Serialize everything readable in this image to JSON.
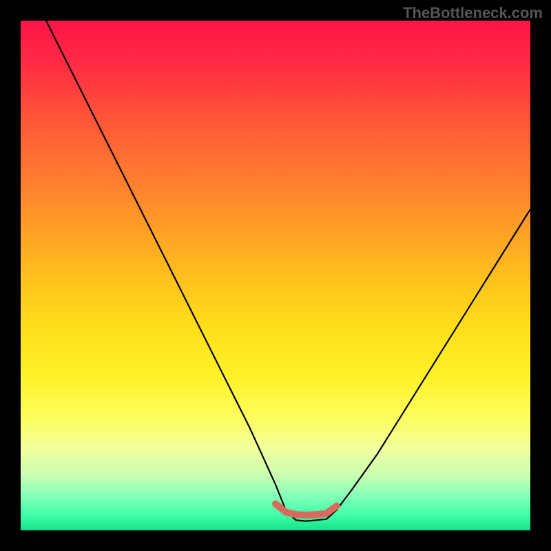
{
  "watermark": "TheBottleneck.com",
  "chart_data": {
    "type": "line",
    "title": "",
    "xlabel": "",
    "ylabel": "",
    "xlim": [
      0,
      100
    ],
    "ylim": [
      0,
      100
    ],
    "grid": false,
    "series": [
      {
        "name": "bottleneck-curve",
        "x": [
          0,
          5,
          10,
          15,
          20,
          25,
          30,
          35,
          40,
          45,
          50,
          52,
          54,
          56,
          58,
          60,
          62,
          65,
          70,
          75,
          80,
          85,
          90,
          95,
          100
        ],
        "values": [
          110,
          100,
          90,
          80,
          70,
          60,
          50,
          40,
          30,
          20,
          9,
          4,
          2,
          1.8,
          2,
          2.2,
          4,
          8,
          15,
          23,
          31,
          39,
          47,
          55,
          63
        ]
      },
      {
        "name": "flat-zone-marker",
        "x": [
          50,
          52,
          54,
          56,
          58,
          60,
          62
        ],
        "values": [
          5.2,
          3.6,
          3.1,
          3.0,
          3.1,
          3.3,
          4.8
        ]
      }
    ],
    "annotations": [],
    "colors": {
      "curve": "#000000",
      "marker": "#d96a5e",
      "gradient_top": "#ff1449",
      "gradient_bottom": "#14e289"
    }
  }
}
